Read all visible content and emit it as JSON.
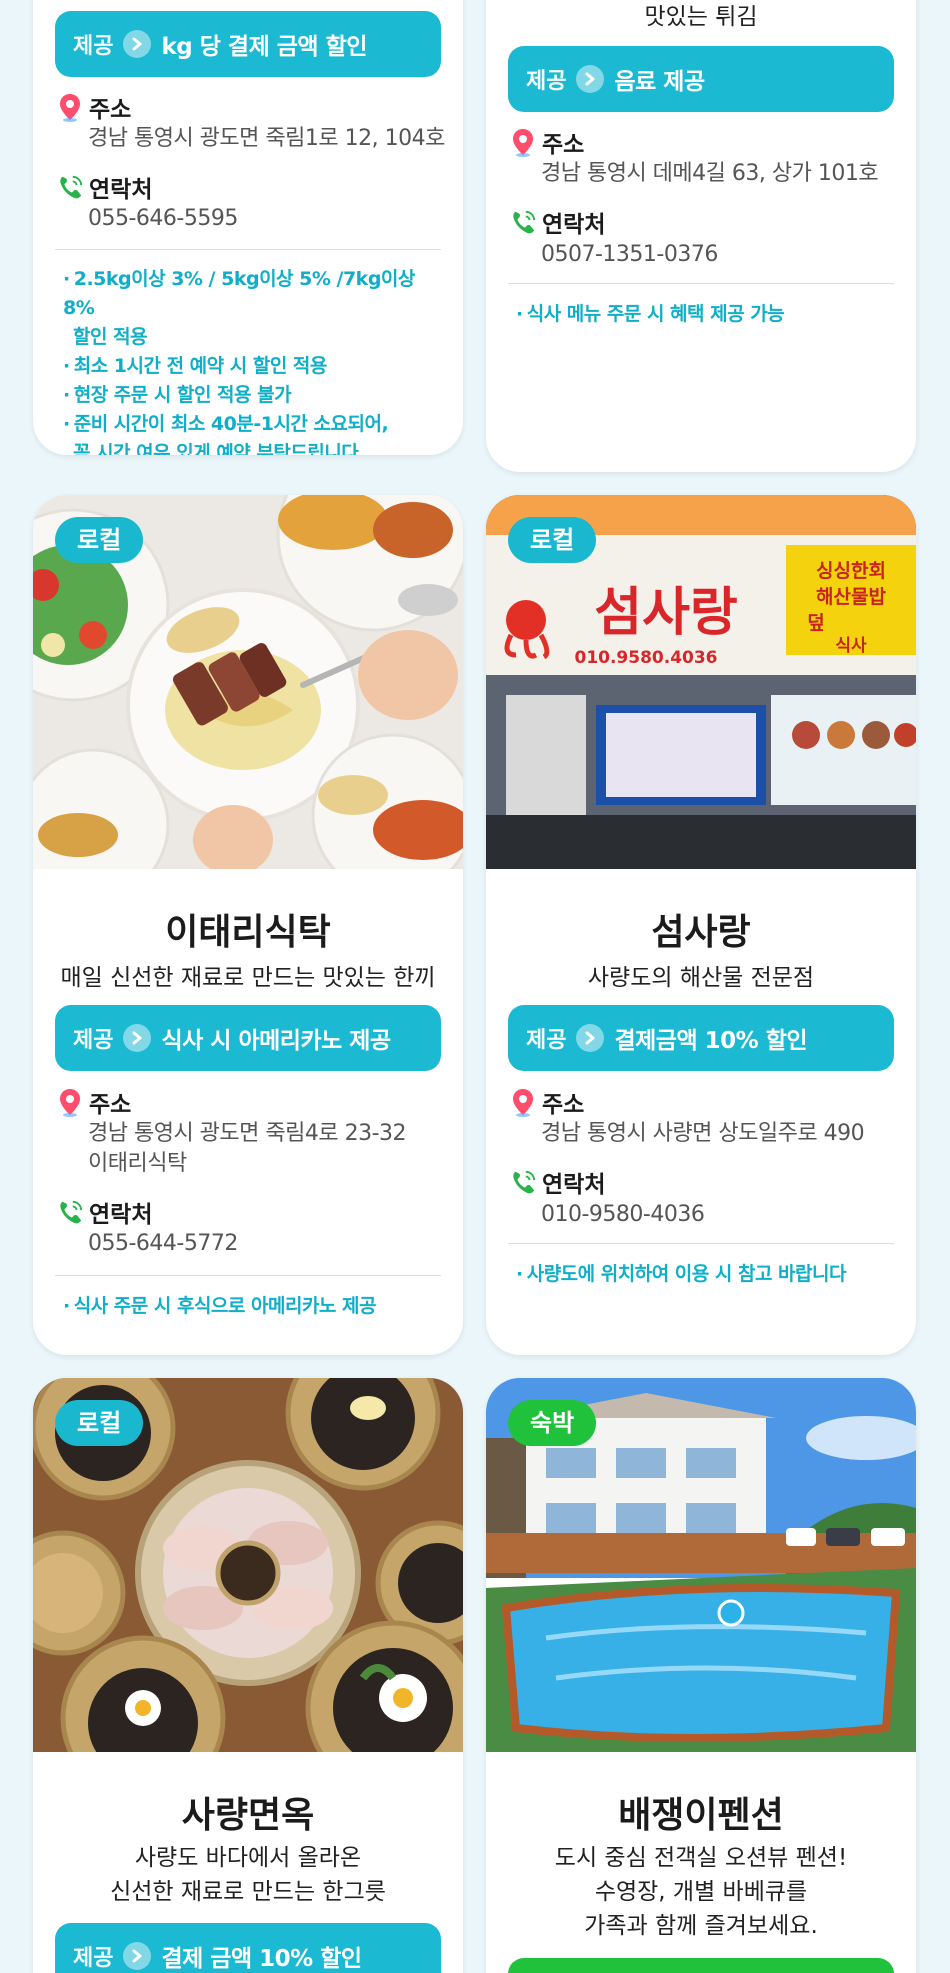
{
  "offer_label": "제공",
  "address_label": "주소",
  "contact_label": "연락처",
  "cards": [
    {
      "offer": "kg 당 결제 금액 할인",
      "address": "경남 통영시 광도면 죽림1로 12, 104호",
      "phone": "055-646-5595",
      "notes": [
        "2.5kg이상 3% / 5kg이상 5% /7kg이상 8%",
        "할인 적용",
        "최소 1시간 전 예약 시 할인 적용",
        "현장 주문 시 할인 적용 불가",
        "준비 시간이 최소 40분-1시간 소요되어,",
        "꼭 시간 여유 있게 예약 부탁드립니다."
      ]
    },
    {
      "subtitle": "맛있는 튀김",
      "offer": "음료 제공",
      "address": "경남 통영시 데메4길 63, 상가 101호",
      "phone": "0507-1351-0376",
      "notes": [
        "식사 메뉴 주문 시 혜택 제공 가능"
      ]
    },
    {
      "tag": "로컬",
      "title": "이태리식탁",
      "subtitle": "매일 신선한 재료로 만드는 맛있는 한끼",
      "offer": "식사 시 아메리카노 제공",
      "address_line1": "경남 통영시 광도면 죽림4로 23-32",
      "address_line2": "이태리식탁",
      "phone": "055-644-5772",
      "notes": [
        "식사 주문 시 후식으로 아메리카노 제공"
      ]
    },
    {
      "tag": "로컬",
      "title": "섬사랑",
      "subtitle": "사량도의 해산물 전문점",
      "offer": "결제금액 10% 할인",
      "address": "경남 통영시 사량면 상도일주로 490",
      "phone": "010-9580-4036",
      "notes": [
        "사량도에 위치하여 이용 시 참고 바랍니다"
      ],
      "sign_name": "섬사랑",
      "sign_phone": "010.9580.4036",
      "sign_menu": [
        "싱싱한회",
        "해산물밥",
        "덮",
        "식사"
      ]
    },
    {
      "tag": "로컬",
      "title": "사량면옥",
      "subtitle_line1": "사량도 바다에서 올라온",
      "subtitle_line2": "신선한 재료로 만드는 한그릇",
      "offer": "결제 금액 10% 할인"
    },
    {
      "tag": "숙박",
      "title": "배쟁이펜션",
      "subtitle_line1": "도시 중심 전객실 오션뷰 펜션!",
      "subtitle_line2": "수영장, 개별 바베큐를",
      "subtitle_line3": "가족과 함께 즐겨보세요."
    }
  ],
  "colors": {
    "accent": "#1cb9d3",
    "stay": "#1fc23a",
    "note": "#11aec8"
  }
}
